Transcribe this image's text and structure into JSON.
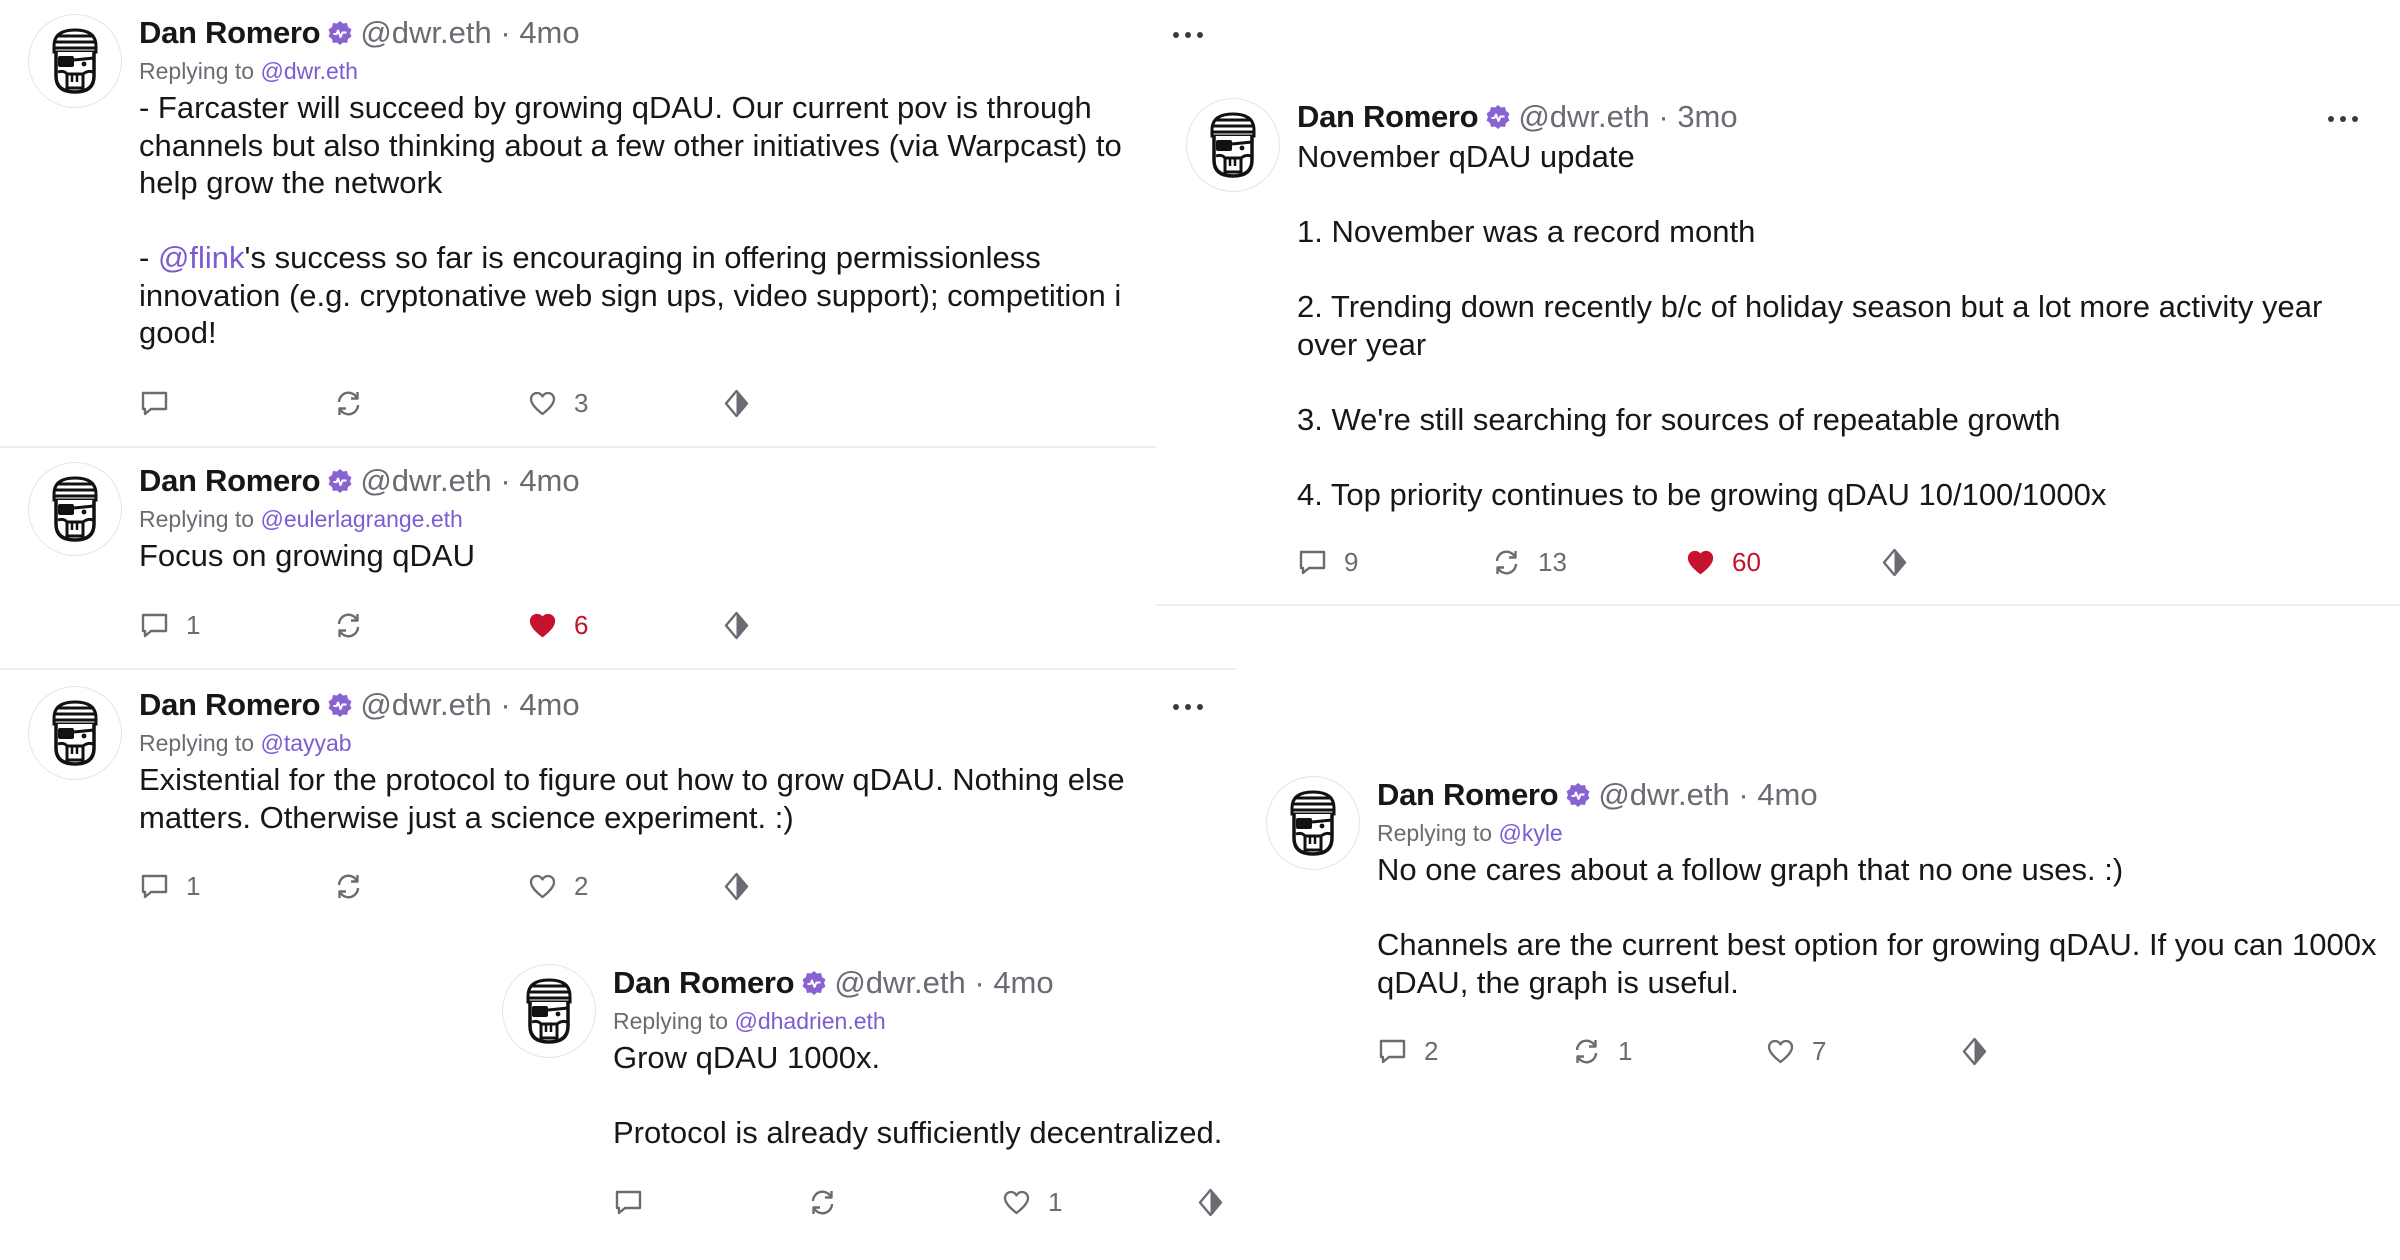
{
  "author": {
    "name": "Dan Romero",
    "handle": "@dwr.eth",
    "separator": "·"
  },
  "reply_prefix": "Replying to",
  "colors": {
    "accent": "#7c5bd3",
    "liked": "#c4122f",
    "muted": "#6b6b73",
    "text": "#171717"
  },
  "icons": [
    "verified-badge-icon",
    "comment-icon",
    "recast-icon",
    "heart-icon",
    "diamond-icon",
    "more-options-icon",
    "pirate-avatar-icon"
  ],
  "posts": [
    {
      "time": "4mo",
      "replying_to": "@dwr.eth",
      "lines": [
        "- Farcaster will succeed by growing qDAU. Our current pov is through",
        "channels but also thinking about a few other initiatives (via Warpcast) to",
        "help grow the network",
        "",
        "@flink",
        "'s success so far is encouraging in offering permissionless",
        "innovation (e.g. cryptonative web sign ups, video support); competition i",
        "good!"
      ],
      "line2_prefix": "- ",
      "comments": "",
      "recasts": "",
      "likes": "3",
      "liked": false
    },
    {
      "time": "4mo",
      "replying_to": "@eulerlagrange.eth",
      "text": "Focus on growing qDAU",
      "comments": "1",
      "recasts": "",
      "likes": "6",
      "liked": true
    },
    {
      "time": "4mo",
      "replying_to": "@tayyab",
      "lines": [
        "Existential for the protocol to figure out how to grow qDAU. Nothing else",
        "matters. Otherwise just a science experiment. :)"
      ],
      "comments": "1",
      "recasts": "",
      "likes": "2",
      "liked": false
    },
    {
      "time": "4mo",
      "replying_to": "@dhadrien.eth",
      "lines": [
        "Grow qDAU 1000x.",
        "Protocol is already sufficiently decentralized."
      ],
      "comments": "",
      "recasts": "",
      "likes": "1",
      "liked": false
    },
    {
      "time": "3mo",
      "lines": [
        "November qDAU update",
        "1. November was a record month",
        "2. Trending down recently b/c of holiday season but a lot more activity year",
        "over year",
        "3. We're still searching for sources of repeatable growth",
        "4. Top priority continues to be growing qDAU 10/100/1000x"
      ],
      "comments": "9",
      "recasts": "13",
      "likes": "60",
      "liked": true
    },
    {
      "time": "4mo",
      "replying_to": "@kyle",
      "lines": [
        "No one cares about a follow graph that no one uses. :)",
        "Channels are the current best option for growing qDAU. If you can 1000x",
        "qDAU, the graph is useful."
      ],
      "comments": "2",
      "recasts": "1",
      "likes": "7",
      "liked": false
    }
  ]
}
